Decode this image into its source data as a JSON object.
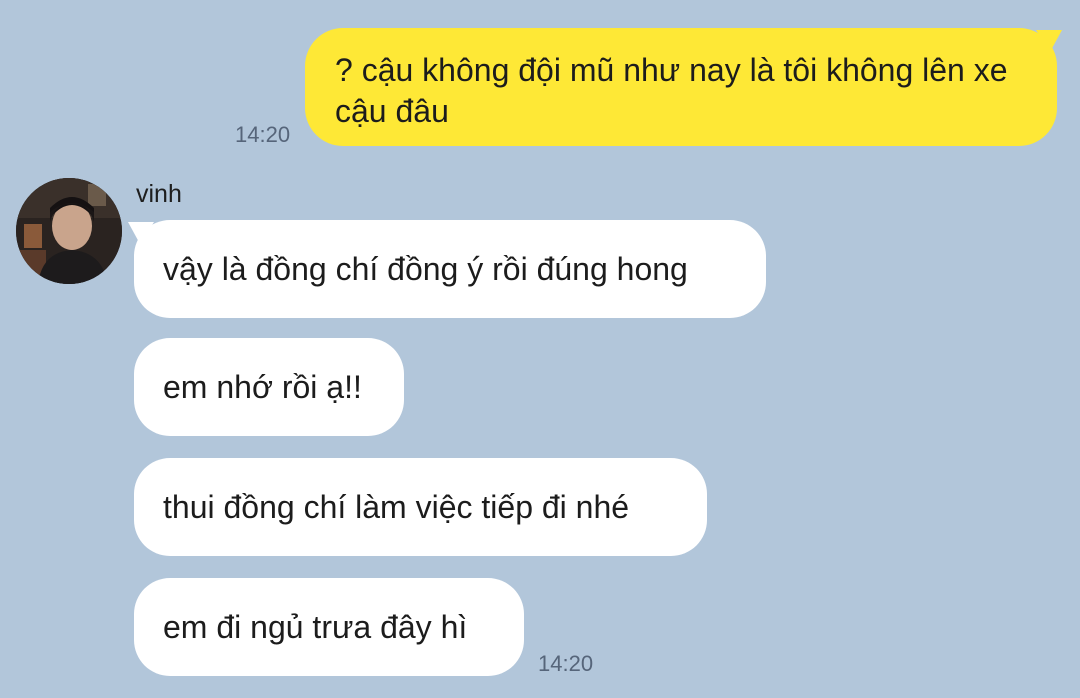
{
  "conversation": {
    "outgoing": {
      "text": "? cậu không đội mũ như nay là tôi không lên xe cậu đâu",
      "time": "14:20"
    },
    "incoming": {
      "sender": "vinh",
      "messages": [
        "vậy là đồng chí đồng ý rồi đúng hong",
        "em nhớ rồi ạ!!",
        "thui đồng chí làm việc tiếp đi nhé",
        "em đi ngủ trưa đây hì"
      ],
      "time": "14:20"
    }
  },
  "colors": {
    "background": "#b2c6da",
    "outgoing_bubble": "#fee836",
    "incoming_bubble": "#ffffff",
    "timestamp": "#56657a"
  }
}
